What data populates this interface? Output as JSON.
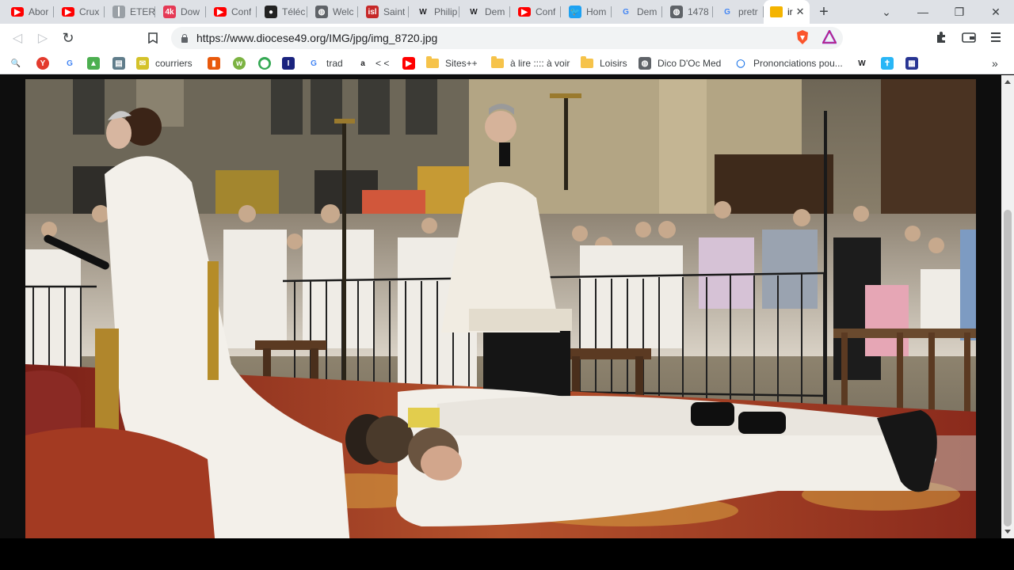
{
  "tabs": [
    {
      "title": "Abor",
      "icon": "youtube-icon",
      "color": "#ff0000"
    },
    {
      "title": "Crux",
      "icon": "youtube-icon",
      "color": "#ff0000"
    },
    {
      "title": "ETER",
      "icon": "bookmark-icon",
      "color": "#9aa0a6"
    },
    {
      "title": "Dow",
      "icon": "4k-icon",
      "color": "#e53955"
    },
    {
      "title": "Conf",
      "icon": "youtube-icon",
      "color": "#ff0000"
    },
    {
      "title": "Téléc",
      "icon": "circle-icon",
      "color": "#222222"
    },
    {
      "title": "Welc",
      "icon": "globe-icon",
      "color": "#5f6368"
    },
    {
      "title": "Saint",
      "icon": "isl-icon",
      "color": "#c62828"
    },
    {
      "title": "Philip",
      "icon": "wikipedia-icon",
      "color": "#ffffff"
    },
    {
      "title": "Dem",
      "icon": "wikipedia-icon",
      "color": "#ffffff"
    },
    {
      "title": "Conf",
      "icon": "youtube-icon",
      "color": "#ff0000"
    },
    {
      "title": "Hom",
      "icon": "twitter-icon",
      "color": "#1da1f2"
    },
    {
      "title": "Dem",
      "icon": "google-icon",
      "color": "#ffffff"
    },
    {
      "title": "1478",
      "icon": "globe-icon",
      "color": "#5f6368"
    },
    {
      "title": "pretr",
      "icon": "google-icon",
      "color": "#ffffff"
    }
  ],
  "active_tab": {
    "title": "ir",
    "close": "✕",
    "icon": "image-icon"
  },
  "new_tab_symbol": "+",
  "window_controls": {
    "chevron": "⌄",
    "minimize": "—",
    "restore": "❐",
    "close": "✕"
  },
  "toolbar": {
    "back": "◁",
    "forward": "▷",
    "reload": "↻",
    "bookmark_star": "🔖",
    "url": "https://www.diocese49.org/IMG/jpg/img_8720.jpg"
  },
  "bookmarks": [
    {
      "label": "",
      "icon": "search-zoom-icon"
    },
    {
      "label": "",
      "icon": "yandex-icon"
    },
    {
      "label": "",
      "icon": "google-icon"
    },
    {
      "label": "",
      "icon": "analytics-icon"
    },
    {
      "label": "",
      "icon": "document-icon"
    },
    {
      "label": "courriers",
      "icon": "mail-icon"
    },
    {
      "label": "",
      "icon": "office-icon"
    },
    {
      "label": "",
      "icon": "wiktionary-icon"
    },
    {
      "label": "",
      "icon": "maps-icon"
    },
    {
      "label": "",
      "icon": "reader-icon"
    },
    {
      "label": "trad",
      "icon": "google-icon"
    },
    {
      "label": "< <",
      "icon": "amazon-icon"
    },
    {
      "label": "",
      "icon": "youtube-icon"
    },
    {
      "label": "Sites++",
      "icon": "folder-icon"
    },
    {
      "label": "à lire :::: à voir",
      "icon": "folder-icon"
    },
    {
      "label": "Loisirs",
      "icon": "folder-icon"
    },
    {
      "label": "Dico D'Oc Med",
      "icon": "globe-icon"
    },
    {
      "label": "Prononciations pou...",
      "icon": "circle-ring-icon"
    },
    {
      "label": "",
      "icon": "wikipedia-icon"
    },
    {
      "label": "",
      "icon": "cross-icon"
    },
    {
      "label": "",
      "icon": "app-icon"
    }
  ],
  "bookmarks_overflow": "»",
  "content": {
    "image_alt": "img_8720.jpg"
  },
  "colors": {
    "tabstrip": "#dee1e6",
    "toolbar": "#ffffff",
    "omnibox": "#f1f3f4",
    "page_bg": "#0e0e0e"
  }
}
